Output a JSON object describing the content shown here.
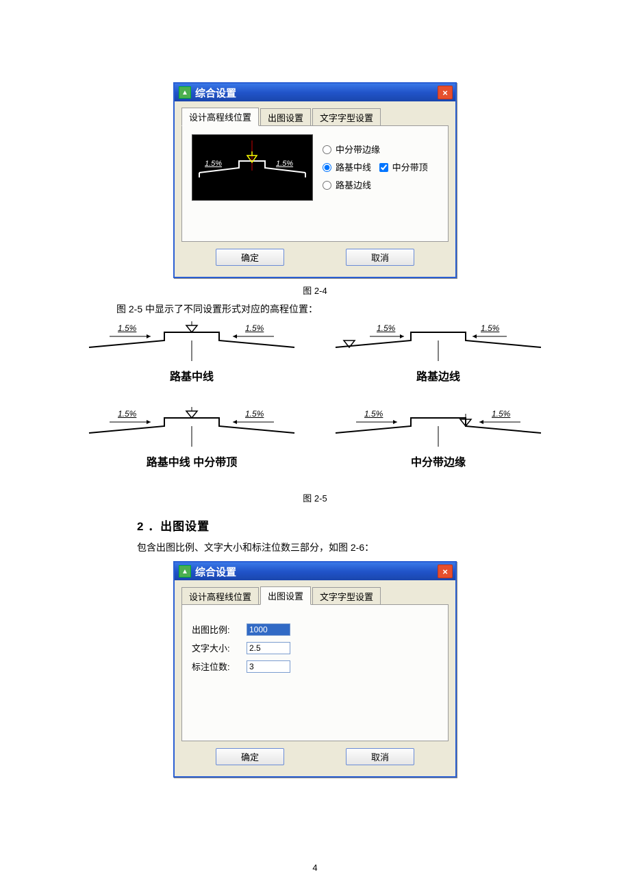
{
  "page_number": "4",
  "dialog1": {
    "title": "综合设置",
    "close_glyph": "×",
    "tabs": {
      "t1": "设计高程线位置",
      "t2": "出图设置",
      "t3": "文字字型设置"
    },
    "preview": {
      "left_pct": "1.5%",
      "right_pct": "1.5%"
    },
    "radios": {
      "r1": "中分带边缘",
      "r2": "路基中线",
      "chk": "中分带顶",
      "r3": "路基边线"
    },
    "buttons": {
      "ok": "确定",
      "cancel": "取消"
    }
  },
  "caption1": "图 2-4",
  "text1": "图 2-5 中显示了不同设置形式对应的高程位置：",
  "cross_sections": {
    "pct": "1.5%",
    "labels": {
      "tl": "路基中线",
      "tr": "路基边线",
      "bl": "路基中线  中分带顶",
      "br": "中分带边缘"
    }
  },
  "caption2": "图 2-5",
  "section2_heading": "2 ．出图设置",
  "text2": "包含出图比例、文字大小和标注位数三部分，如图 2-6：",
  "dialog2": {
    "title": "综合设置",
    "close_glyph": "×",
    "tabs": {
      "t1": "设计高程线位置",
      "t2": "出图设置",
      "t3": "文字字型设置"
    },
    "fields": {
      "scale_label": "出图比例:",
      "scale_value": "1000",
      "font_label": "文字大小:",
      "font_value": "2.5",
      "dec_label": "标注位数:",
      "dec_value": "3"
    },
    "buttons": {
      "ok": "确定",
      "cancel": "取消"
    }
  }
}
